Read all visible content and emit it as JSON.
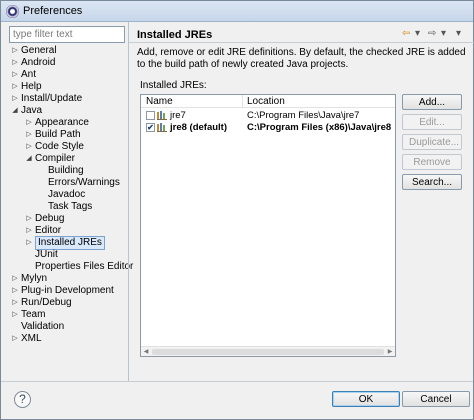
{
  "window": {
    "title": "Preferences"
  },
  "filter": {
    "placeholder": "type filter text"
  },
  "tree": [
    {
      "label": "General",
      "depth": 0,
      "twisty": "collapsed"
    },
    {
      "label": "Android",
      "depth": 0,
      "twisty": "collapsed"
    },
    {
      "label": "Ant",
      "depth": 0,
      "twisty": "collapsed"
    },
    {
      "label": "Help",
      "depth": 0,
      "twisty": "collapsed"
    },
    {
      "label": "Install/Update",
      "depth": 0,
      "twisty": "collapsed"
    },
    {
      "label": "Java",
      "depth": 0,
      "twisty": "expanded"
    },
    {
      "label": "Appearance",
      "depth": 1,
      "twisty": "collapsed"
    },
    {
      "label": "Build Path",
      "depth": 1,
      "twisty": "collapsed"
    },
    {
      "label": "Code Style",
      "depth": 1,
      "twisty": "collapsed"
    },
    {
      "label": "Compiler",
      "depth": 1,
      "twisty": "expanded"
    },
    {
      "label": "Building",
      "depth": 2,
      "twisty": "none"
    },
    {
      "label": "Errors/Warnings",
      "depth": 2,
      "twisty": "none"
    },
    {
      "label": "Javadoc",
      "depth": 2,
      "twisty": "none"
    },
    {
      "label": "Task Tags",
      "depth": 2,
      "twisty": "none"
    },
    {
      "label": "Debug",
      "depth": 1,
      "twisty": "collapsed"
    },
    {
      "label": "Editor",
      "depth": 1,
      "twisty": "collapsed"
    },
    {
      "label": "Installed JREs",
      "depth": 1,
      "twisty": "collapsed",
      "selected": true
    },
    {
      "label": "JUnit",
      "depth": 1,
      "twisty": "none"
    },
    {
      "label": "Properties Files Editor",
      "depth": 1,
      "twisty": "none"
    },
    {
      "label": "Mylyn",
      "depth": 0,
      "twisty": "collapsed"
    },
    {
      "label": "Plug-in Development",
      "depth": 0,
      "twisty": "collapsed"
    },
    {
      "label": "Run/Debug",
      "depth": 0,
      "twisty": "collapsed"
    },
    {
      "label": "Team",
      "depth": 0,
      "twisty": "collapsed"
    },
    {
      "label": "Validation",
      "depth": 0,
      "twisty": "none"
    },
    {
      "label": "XML",
      "depth": 0,
      "twisty": "collapsed"
    }
  ],
  "page": {
    "title": "Installed JREs",
    "description": "Add, remove or edit JRE definitions. By default, the checked JRE is added to the build path of newly created Java projects.",
    "section_label": "Installed JREs:"
  },
  "table": {
    "columns": {
      "name": "Name",
      "location": "Location"
    },
    "rows": [
      {
        "checked": false,
        "name": "jre7",
        "location": "C:\\Program Files\\Java\\jre7",
        "default": false
      },
      {
        "checked": true,
        "name": "jre8 (default)",
        "location": "C:\\Program Files (x86)\\Java\\jre8",
        "default": true
      }
    ]
  },
  "buttons": {
    "add": "Add...",
    "edit": "Edit...",
    "duplicate": "Duplicate...",
    "remove": "Remove",
    "search": "Search...",
    "ok": "OK",
    "cancel": "Cancel"
  },
  "icons": {
    "help": "?",
    "back": "⇦",
    "forward": "⇨",
    "dropdown": "▾"
  },
  "colors": {
    "selection_bg": "#d9e8fb",
    "selection_border": "#7da2ce"
  }
}
